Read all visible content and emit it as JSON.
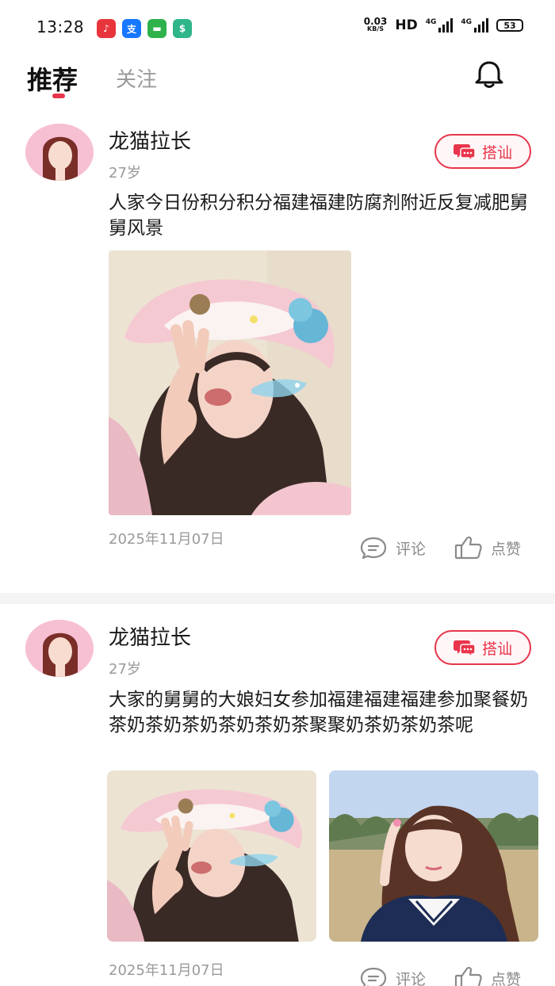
{
  "status_bar": {
    "time": "13:28",
    "net_speed": "0.03",
    "net_unit": "KB/S",
    "hd": "HD",
    "signal1_label": "4G",
    "signal2_label": "4G",
    "battery": "53",
    "app_icons": [
      "music-app-icon",
      "alipay-app-icon",
      "message-app-icon",
      "shield-app-icon"
    ]
  },
  "header": {
    "tab_recommend": "推荐",
    "tab_follow": "关注",
    "accent": "#e8354b"
  },
  "posts": [
    {
      "username": "龙猫拉长",
      "age": "27岁",
      "chat_label": "搭讪",
      "content": "人家今日份积分积分福建福建防腐剂附近反复减肥舅舅风景",
      "date": "2025年11月07日",
      "comment_label": "评论",
      "like_label": "点赞"
    },
    {
      "username": "龙猫拉长",
      "age": "27岁",
      "chat_label": "搭讪",
      "content": "大家的舅舅的大娘妇女参加福建福建福建参加聚餐奶茶奶茶奶茶奶茶奶茶奶茶聚聚奶茶奶茶奶茶呢",
      "date": "2025年11月07日",
      "comment_label": "评论",
      "like_label": "点赞"
    }
  ]
}
